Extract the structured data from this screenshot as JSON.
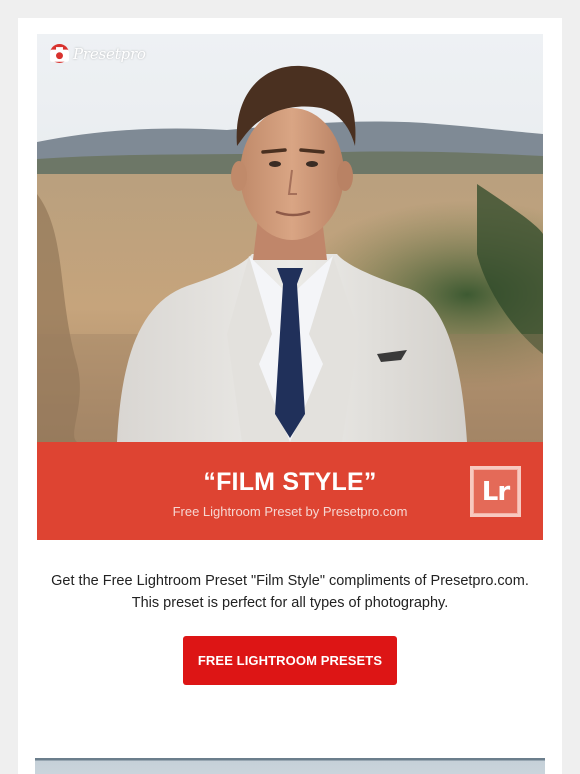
{
  "brand": {
    "logo_text": "Presetpro",
    "logo_icon": "camera-icon",
    "accent_color": "#de4432",
    "cta_color": "#dd1515"
  },
  "hero": {
    "image_alt": "Man in light grey suit with navy tie standing in a vineyard"
  },
  "banner": {
    "title": "“FILM STYLE”",
    "subtitle": "Free Lightroom Preset by Presetpro.com",
    "badge_text": "Lr"
  },
  "body": {
    "description": "Get the Free Lightroom Preset \"Film Style\" compliments of Presetpro.com. This preset is perfect for all types of photography."
  },
  "cta": {
    "label": "FREE LIGHTROOM PRESETS"
  }
}
